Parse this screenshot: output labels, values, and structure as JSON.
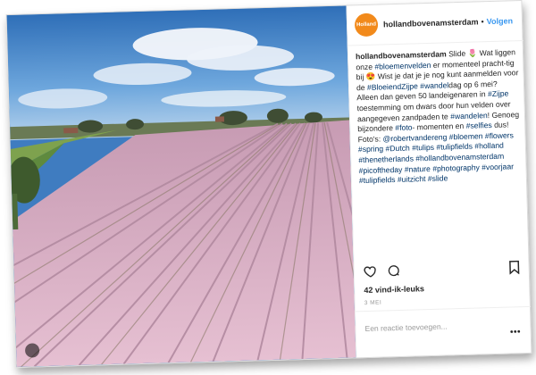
{
  "header": {
    "avatar_text": "Holland",
    "username": "hollandbovenamsterdam",
    "separator": "•",
    "follow_label": "Volgen"
  },
  "caption": {
    "username": "hollandbovenamsterdam",
    "parts": [
      {
        "text": "Slide ",
        "tag": false
      },
      {
        "text": "🌷",
        "tag": false
      },
      {
        "text": " Wat liggen onze ",
        "tag": false
      },
      {
        "text": "#bloemenvelden",
        "tag": true
      },
      {
        "text": " er momenteel pracht-tig bij ",
        "tag": false
      },
      {
        "text": "😍",
        "tag": false
      },
      {
        "text": " Wist je dat je je nog kunt aanmelden voor de ",
        "tag": false
      },
      {
        "text": "#BloeiendZijpe",
        "tag": true
      },
      {
        "text": " ",
        "tag": false
      },
      {
        "text": "#wandel",
        "tag": true
      },
      {
        "text": "dag op 6 mei? Alleen dan geven 50 landeigenaren in ",
        "tag": false
      },
      {
        "text": "#Zijpe",
        "tag": true
      },
      {
        "text": " toestemming om dwars door hun velden over aangegeven zandpaden te ",
        "tag": false
      },
      {
        "text": "#wandelen",
        "tag": true
      },
      {
        "text": "! Genoeg bijzondere ",
        "tag": false
      },
      {
        "text": "#foto",
        "tag": true
      },
      {
        "text": "- momenten en ",
        "tag": false
      },
      {
        "text": "#selfies",
        "tag": true
      },
      {
        "text": " dus! Foto's: ",
        "tag": false
      },
      {
        "text": "@robertvandereng",
        "tag": true
      },
      {
        "text": " ",
        "tag": false
      },
      {
        "text": "#bloemen",
        "tag": true
      },
      {
        "text": " ",
        "tag": false
      },
      {
        "text": "#flowers",
        "tag": true
      },
      {
        "text": " ",
        "tag": false
      },
      {
        "text": "#spring",
        "tag": true
      },
      {
        "text": " ",
        "tag": false
      },
      {
        "text": "#Dutch",
        "tag": true
      },
      {
        "text": " ",
        "tag": false
      },
      {
        "text": "#tulips",
        "tag": true
      },
      {
        "text": " ",
        "tag": false
      },
      {
        "text": "#tulipfields",
        "tag": true
      },
      {
        "text": " ",
        "tag": false
      },
      {
        "text": "#holland",
        "tag": true
      },
      {
        "text": " ",
        "tag": false
      },
      {
        "text": "#thenetherlands",
        "tag": true
      },
      {
        "text": " ",
        "tag": false
      },
      {
        "text": "#hollandbovenamsterdam",
        "tag": true
      },
      {
        "text": " ",
        "tag": false
      },
      {
        "text": "#picoftheday",
        "tag": true
      },
      {
        "text": " ",
        "tag": false
      },
      {
        "text": "#nature",
        "tag": true
      },
      {
        "text": " ",
        "tag": false
      },
      {
        "text": "#photography",
        "tag": true
      },
      {
        "text": " ",
        "tag": false
      },
      {
        "text": "#voorjaar",
        "tag": true
      },
      {
        "text": " ",
        "tag": false
      },
      {
        "text": "#tulipfields",
        "tag": true
      },
      {
        "text": " ",
        "tag": false
      },
      {
        "text": "#uitzicht",
        "tag": true
      },
      {
        "text": " ",
        "tag": false
      },
      {
        "text": "#slide",
        "tag": true
      }
    ]
  },
  "actions": {
    "like_icon": "heart-icon",
    "comment_icon": "comment-icon",
    "save_icon": "bookmark-icon"
  },
  "likes_label": "42 vind-ik-leuks",
  "date_label": "3 MEI",
  "comment": {
    "placeholder": "Een reactie toevoegen...",
    "more_icon": "more-options-icon"
  },
  "colors": {
    "link": "#3897f0",
    "hashtag": "#003569",
    "avatar": "#f28a1b",
    "sky": "#3f7cc0",
    "field_pink": "#d9a6bf"
  }
}
